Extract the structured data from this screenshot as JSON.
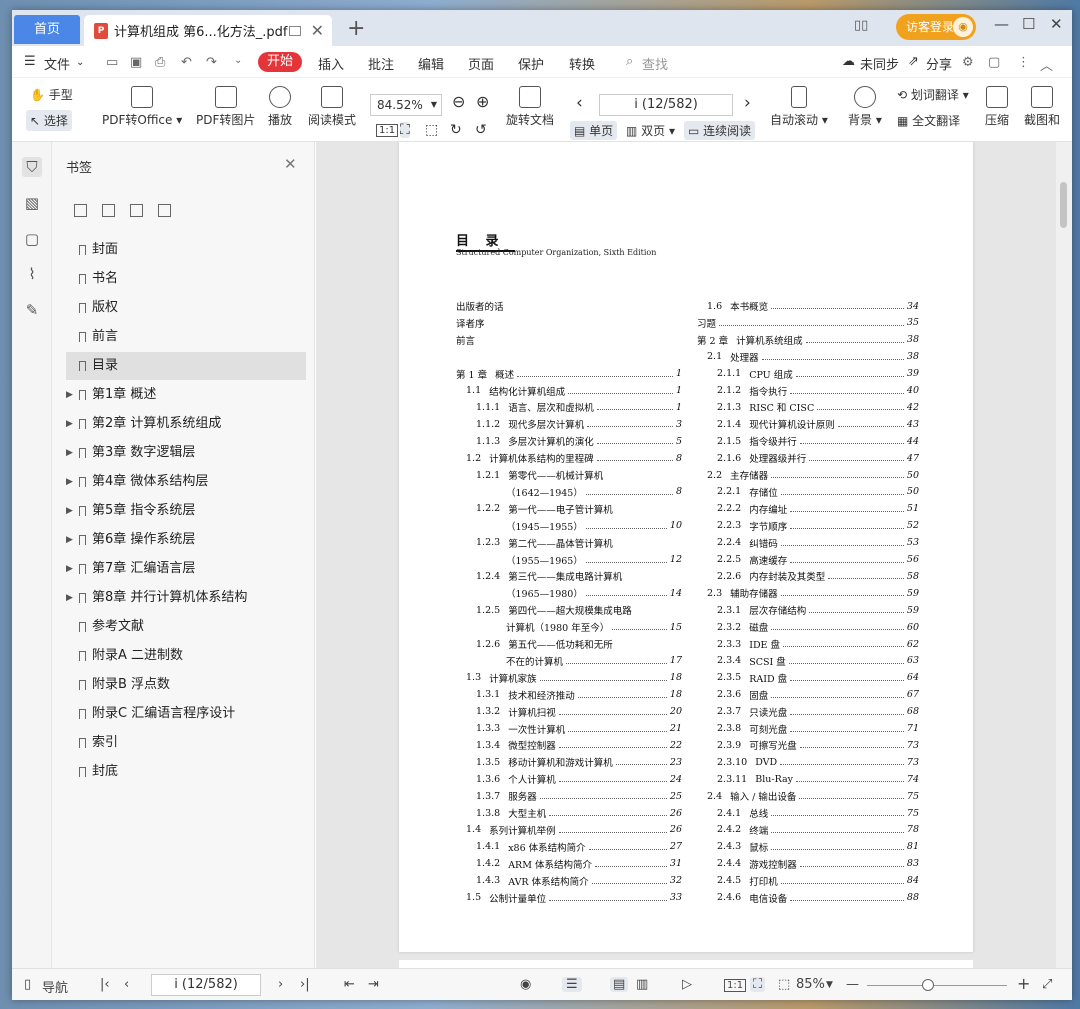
{
  "titlebar": {
    "home_tab": "首页",
    "doc_tab": "计算机组成 第6...化方法_.pdf",
    "pdf_badge": "P",
    "visitor": "访客登录"
  },
  "menu": {
    "file": "文件",
    "start": "开始",
    "items": [
      "插入",
      "批注",
      "编辑",
      "页面",
      "保护",
      "转换"
    ],
    "search": "查找",
    "sync": "未同步",
    "share": "分享"
  },
  "ribbon": {
    "hand": "手型",
    "select": "选择",
    "pdf_to_office": "PDF转Office",
    "pdf_to_image": "PDF转图片",
    "play": "播放",
    "reading": "阅读模式",
    "zoom": "84.52%",
    "page": "i (12/582)",
    "rotate": "旋转文档",
    "single": "单页",
    "double": "双页",
    "continuous": "连续阅读",
    "auto_scroll": "自动滚动",
    "background": "背景",
    "word_translate": "划词翻译",
    "full_translate": "全文翻译",
    "compress": "压缩",
    "screenshot": "截图和"
  },
  "bookmarks": {
    "title": "书签",
    "items": [
      {
        "label": "封面",
        "expandable": false,
        "active": false
      },
      {
        "label": "书名",
        "expandable": false,
        "active": false
      },
      {
        "label": "版权",
        "expandable": false,
        "active": false
      },
      {
        "label": "前言",
        "expandable": false,
        "active": false
      },
      {
        "label": "目录",
        "expandable": false,
        "active": true
      },
      {
        "label": "第1章  概述",
        "expandable": true,
        "active": false
      },
      {
        "label": "第2章  计算机系统组成",
        "expandable": true,
        "active": false
      },
      {
        "label": "第3章  数字逻辑层",
        "expandable": true,
        "active": false
      },
      {
        "label": "第4章  微体系结构层",
        "expandable": true,
        "active": false
      },
      {
        "label": "第5章  指令系统层",
        "expandable": true,
        "active": false
      },
      {
        "label": "第6章  操作系统层",
        "expandable": true,
        "active": false
      },
      {
        "label": "第7章  汇编语言层",
        "expandable": true,
        "active": false
      },
      {
        "label": "第8章  并行计算机体系结构",
        "expandable": true,
        "active": false
      },
      {
        "label": "参考文献",
        "expandable": false,
        "active": false
      },
      {
        "label": "附录A  二进制数",
        "expandable": false,
        "active": false
      },
      {
        "label": "附录B  浮点数",
        "expandable": false,
        "active": false
      },
      {
        "label": "附录C  汇编语言程序设计",
        "expandable": false,
        "active": false
      },
      {
        "label": "索引",
        "expandable": false,
        "active": false
      },
      {
        "label": "封底",
        "expandable": false,
        "active": false
      }
    ]
  },
  "toc": {
    "heading": "目  录",
    "subtitle": "Structured Computer Organization, Sixth Edition",
    "left": [
      {
        "n": "",
        "t": "出版者的话",
        "p": ""
      },
      {
        "n": "",
        "t": "译者序",
        "p": ""
      },
      {
        "n": "",
        "t": "前言",
        "p": ""
      },
      {
        "n": "",
        "t": "",
        "p": ""
      },
      {
        "n": "第 1 章",
        "t": "概述",
        "p": "1"
      },
      {
        "n": "1.1",
        "t": "结构化计算机组成",
        "p": "1"
      },
      {
        "n": "1.1.1",
        "t": "语言、层次和虚拟机",
        "p": "1"
      },
      {
        "n": "1.1.2",
        "t": "现代多层次计算机",
        "p": "3"
      },
      {
        "n": "1.1.3",
        "t": "多层次计算机的演化",
        "p": "5"
      },
      {
        "n": "1.2",
        "t": "计算机体系结构的里程碑",
        "p": "8"
      },
      {
        "n": "1.2.1",
        "t": "第零代——机械计算机",
        "p": ""
      },
      {
        "n": "",
        "t": "（1642—1945）",
        "p": "8"
      },
      {
        "n": "1.2.2",
        "t": "第一代——电子管计算机",
        "p": ""
      },
      {
        "n": "",
        "t": "（1945—1955）",
        "p": "10"
      },
      {
        "n": "1.2.3",
        "t": "第二代——晶体管计算机",
        "p": ""
      },
      {
        "n": "",
        "t": "（1955—1965）",
        "p": "12"
      },
      {
        "n": "1.2.4",
        "t": "第三代——集成电路计算机",
        "p": ""
      },
      {
        "n": "",
        "t": "（1965—1980）",
        "p": "14"
      },
      {
        "n": "1.2.5",
        "t": "第四代——超大规模集成电路",
        "p": ""
      },
      {
        "n": "",
        "t": "计算机（1980 年至今）",
        "p": "15"
      },
      {
        "n": "1.2.6",
        "t": "第五代——低功耗和无所",
        "p": ""
      },
      {
        "n": "",
        "t": "不在的计算机",
        "p": "17"
      },
      {
        "n": "1.3",
        "t": "计算机家族",
        "p": "18"
      },
      {
        "n": "1.3.1",
        "t": "技术和经济推动",
        "p": "18"
      },
      {
        "n": "1.3.2",
        "t": "计算机扫视",
        "p": "20"
      },
      {
        "n": "1.3.3",
        "t": "一次性计算机",
        "p": "21"
      },
      {
        "n": "1.3.4",
        "t": "微型控制器",
        "p": "22"
      },
      {
        "n": "1.3.5",
        "t": "移动计算机和游戏计算机",
        "p": "23"
      },
      {
        "n": "1.3.6",
        "t": "个人计算机",
        "p": "24"
      },
      {
        "n": "1.3.7",
        "t": "服务器",
        "p": "25"
      },
      {
        "n": "1.3.8",
        "t": "大型主机",
        "p": "26"
      },
      {
        "n": "1.4",
        "t": "系列计算机举例",
        "p": "26"
      },
      {
        "n": "1.4.1",
        "t": "x86 体系结构简介",
        "p": "27"
      },
      {
        "n": "1.4.2",
        "t": "ARM 体系结构简介",
        "p": "31"
      },
      {
        "n": "1.4.3",
        "t": "AVR 体系结构简介",
        "p": "32"
      },
      {
        "n": "1.5",
        "t": "公制计量单位",
        "p": "33"
      }
    ],
    "right": [
      {
        "n": "1.6",
        "t": "本书概览",
        "p": "34"
      },
      {
        "n": "",
        "t": "习题",
        "p": "35"
      },
      {
        "n": "第 2 章",
        "t": "计算机系统组成",
        "p": "38"
      },
      {
        "n": "2.1",
        "t": "处理器",
        "p": "38"
      },
      {
        "n": "2.1.1",
        "t": "CPU 组成",
        "p": "39"
      },
      {
        "n": "2.1.2",
        "t": "指令执行",
        "p": "40"
      },
      {
        "n": "2.1.3",
        "t": "RISC 和 CISC",
        "p": "42"
      },
      {
        "n": "2.1.4",
        "t": "现代计算机设计原则",
        "p": "43"
      },
      {
        "n": "2.1.5",
        "t": "指令级并行",
        "p": "44"
      },
      {
        "n": "2.1.6",
        "t": "处理器级并行",
        "p": "47"
      },
      {
        "n": "2.2",
        "t": "主存储器",
        "p": "50"
      },
      {
        "n": "2.2.1",
        "t": "存储位",
        "p": "50"
      },
      {
        "n": "2.2.2",
        "t": "内存编址",
        "p": "51"
      },
      {
        "n": "2.2.3",
        "t": "字节顺序",
        "p": "52"
      },
      {
        "n": "2.2.4",
        "t": "纠错码",
        "p": "53"
      },
      {
        "n": "2.2.5",
        "t": "高速缓存",
        "p": "56"
      },
      {
        "n": "2.2.6",
        "t": "内存封装及其类型",
        "p": "58"
      },
      {
        "n": "2.3",
        "t": "辅助存储器",
        "p": "59"
      },
      {
        "n": "2.3.1",
        "t": "层次存储结构",
        "p": "59"
      },
      {
        "n": "2.3.2",
        "t": "磁盘",
        "p": "60"
      },
      {
        "n": "2.3.3",
        "t": "IDE 盘",
        "p": "62"
      },
      {
        "n": "2.3.4",
        "t": "SCSI 盘",
        "p": "63"
      },
      {
        "n": "2.3.5",
        "t": "RAID 盘",
        "p": "64"
      },
      {
        "n": "2.3.6",
        "t": "固盘",
        "p": "67"
      },
      {
        "n": "2.3.7",
        "t": "只读光盘",
        "p": "68"
      },
      {
        "n": "2.3.8",
        "t": "可刻光盘",
        "p": "71"
      },
      {
        "n": "2.3.9",
        "t": "可擦写光盘",
        "p": "73"
      },
      {
        "n": "2.3.10",
        "t": "DVD",
        "p": "73"
      },
      {
        "n": "2.3.11",
        "t": "Blu-Ray",
        "p": "74"
      },
      {
        "n": "2.4",
        "t": "输入 / 输出设备",
        "p": "75"
      },
      {
        "n": "2.4.1",
        "t": "总线",
        "p": "75"
      },
      {
        "n": "2.4.2",
        "t": "终端",
        "p": "78"
      },
      {
        "n": "2.4.3",
        "t": "鼠标",
        "p": "81"
      },
      {
        "n": "2.4.4",
        "t": "游戏控制器",
        "p": "83"
      },
      {
        "n": "2.4.5",
        "t": "打印机",
        "p": "84"
      },
      {
        "n": "2.4.6",
        "t": "电信设备",
        "p": "88"
      }
    ]
  },
  "status": {
    "nav": "导航",
    "page": "i (12/582)",
    "zoom": "85%"
  }
}
